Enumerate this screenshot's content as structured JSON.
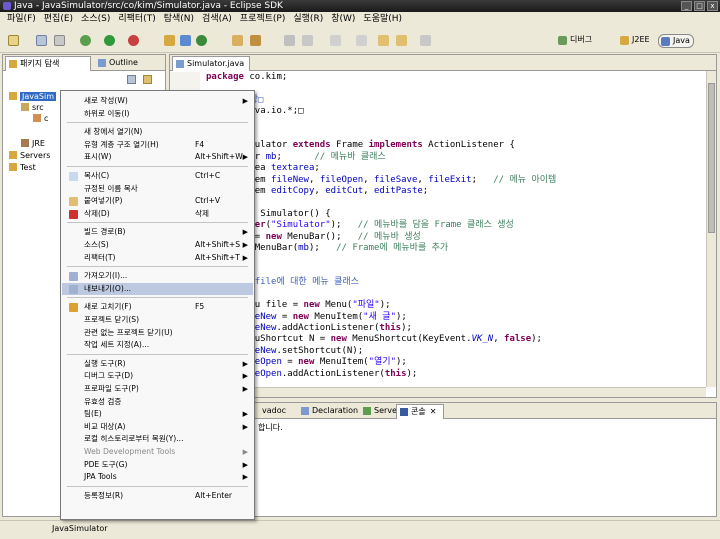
{
  "window": {
    "title": "Java - JavaSimulator/src/co/kim/Simulator.java - Eclipse SDK",
    "minimize": "_",
    "maximize": "□",
    "close": "x"
  },
  "menubar": [
    "파일(F)",
    "편집(E)",
    "소스(S)",
    "리팩터(T)",
    "탐색(N)",
    "검색(A)",
    "프로젝트(P)",
    "실행(R)",
    "창(W)",
    "도움말(H)"
  ],
  "perspectives": {
    "debug": "디버그",
    "j2ee": "J2EE",
    "java": "Java"
  },
  "left_panel": {
    "tab_active": "패키지 탐색",
    "tab_outline": "Outline",
    "tree": {
      "project": "JavaSim",
      "src": "src",
      "package": "c",
      "jre": "JRE",
      "servers": "Servers",
      "test": "Test"
    }
  },
  "editor": {
    "tab": "Simulator.java"
  },
  "bottom_panel": {
    "tabs": [
      "vadoc",
      "Declaration",
      "Servers",
      "콘솔"
    ],
    "console_text": "합니다."
  },
  "statusbar": {
    "text": "JavaSimulator"
  },
  "context_menu": {
    "items": [
      {
        "label": "새로 작성(W)",
        "arrow": true
      },
      {
        "label": "하위로 이동(I)"
      },
      {
        "sep": true
      },
      {
        "label": "새 창에서 열기(N)"
      },
      {
        "label": "유형 계층 구조 열기(H)",
        "shortcut": "F4"
      },
      {
        "label": "표시(W)",
        "shortcut": "Alt+Shift+W",
        "arrow": true
      },
      {
        "sep": true
      },
      {
        "label": "복사(C)",
        "shortcut": "Ctrl+C",
        "icon": "copy-icon"
      },
      {
        "label": "규정된 이름 복사"
      },
      {
        "label": "붙여넣기(P)",
        "shortcut": "Ctrl+V",
        "icon": "paste-icon"
      },
      {
        "label": "삭제(D)",
        "shortcut": "삭제",
        "icon": "delete-icon"
      },
      {
        "sep": true
      },
      {
        "label": "빌드 경로(B)",
        "arrow": true
      },
      {
        "label": "소스(S)",
        "shortcut": "Alt+Shift+S",
        "arrow": true
      },
      {
        "label": "리팩터(T)",
        "shortcut": "Alt+Shift+T",
        "arrow": true
      },
      {
        "sep": true
      },
      {
        "label": "가져오기(I)...",
        "icon": "import-icon"
      },
      {
        "label": "내보내기(O)...",
        "icon": "export-icon",
        "highlight": true
      },
      {
        "sep": true
      },
      {
        "label": "새로 고치기(F)",
        "shortcut": "F5",
        "icon": "refresh-icon"
      },
      {
        "label": "프로젝트 닫기(S)"
      },
      {
        "label": "관련 없는 프로젝트 닫기(U)"
      },
      {
        "label": "작업 세트 지정(A)..."
      },
      {
        "sep": true
      },
      {
        "label": "실행 도구(R)",
        "arrow": true
      },
      {
        "label": "디버그 도구(D)",
        "arrow": true
      },
      {
        "label": "프로파일 도구(P)",
        "arrow": true
      },
      {
        "label": "유효성 검증"
      },
      {
        "label": "팀(E)",
        "arrow": true
      },
      {
        "label": "비교 대상(A)",
        "arrow": true
      },
      {
        "label": "로컬 히스토리로부터 복원(Y)..."
      },
      {
        "label": "Web Development Tools",
        "arrow": true,
        "disabled": true
      },
      {
        "label": "PDE 도구(G)",
        "arrow": true
      },
      {
        "label": "JPA Tools",
        "arrow": true
      },
      {
        "sep": true
      },
      {
        "label": "등록정보(R)",
        "shortcut": "Alt+Enter"
      }
    ]
  },
  "colors": {
    "keyword": "#7f0055",
    "comment": "#3f7f5f",
    "string": "#2a00ff",
    "javadoc": "#3f5fbf",
    "menu_highlight": "#bcc9e0"
  }
}
